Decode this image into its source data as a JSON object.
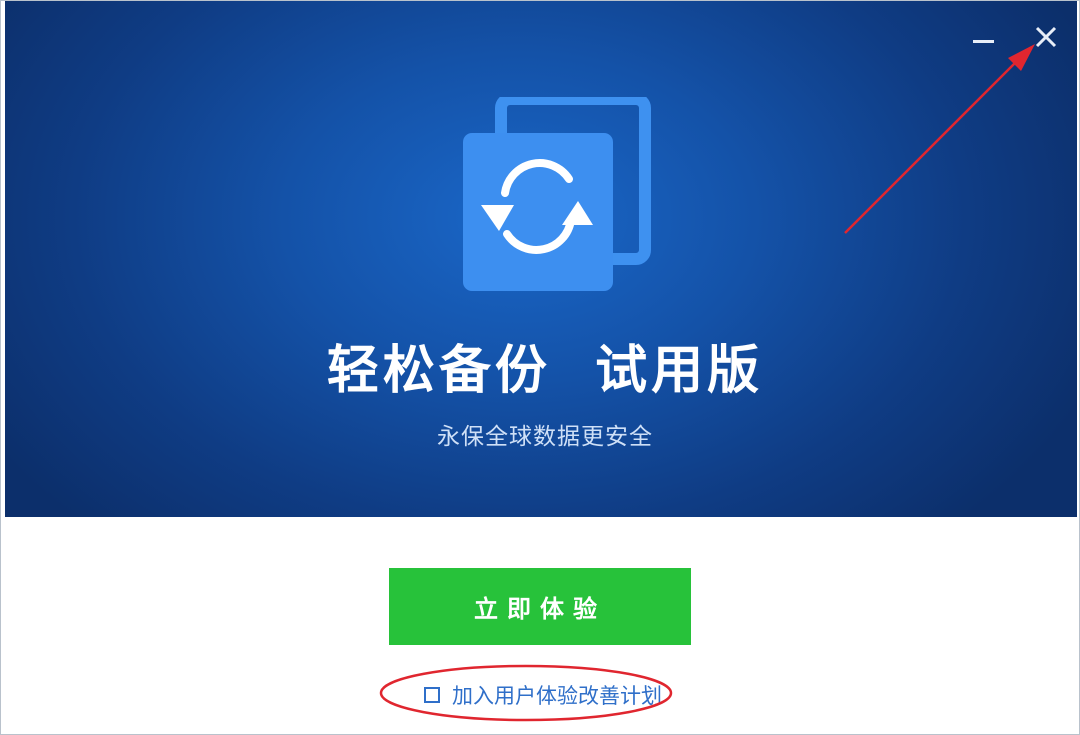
{
  "window": {
    "minimize_icon": "minimize-icon",
    "close_icon": "close-icon"
  },
  "hero": {
    "logo_icon": "backup-sync-icon",
    "title": "轻松备份  试用版",
    "subtitle": "永保全球数据更安全",
    "gradient_colors": [
      "#1a67c8",
      "#1452a8",
      "#0f3c84",
      "#0c2f6b"
    ]
  },
  "actions": {
    "start_label": "立即体验",
    "start_color": "#27c23a",
    "join_checkbox_checked": false,
    "join_label": "加入用户体验改善计划"
  },
  "annotations": {
    "color": "#e0262f",
    "arrow_target": "close-button",
    "ellipse_target": "join-program-option"
  }
}
